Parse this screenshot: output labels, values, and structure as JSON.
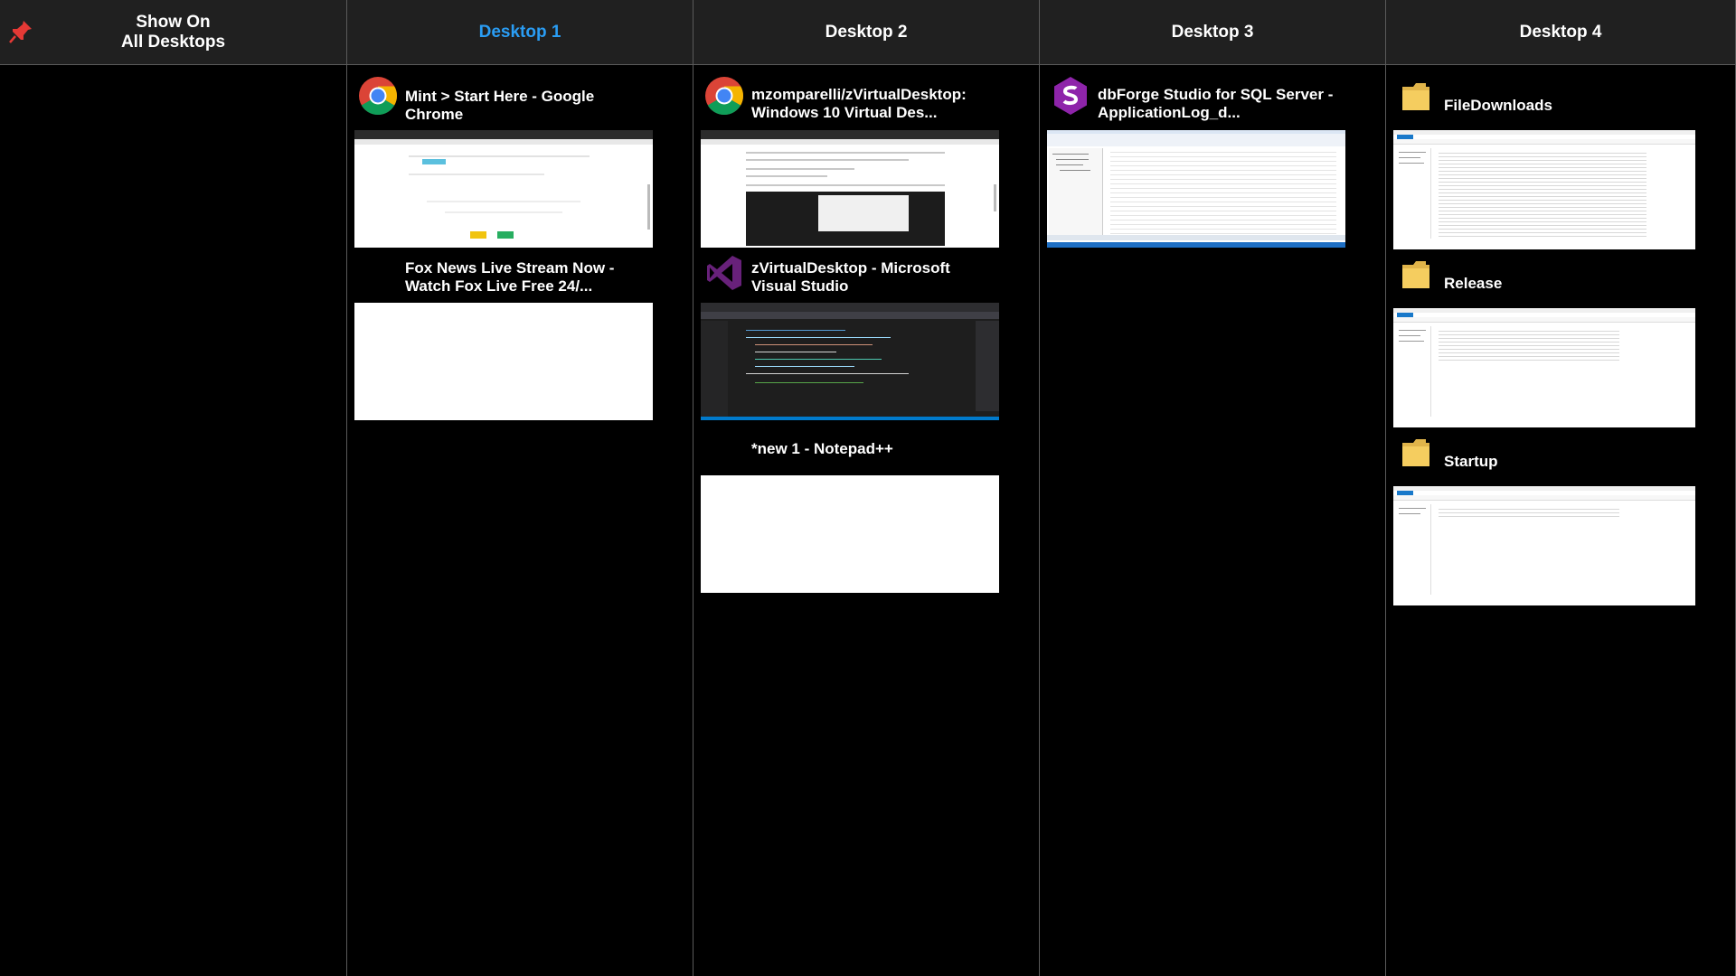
{
  "header": {
    "pinned_label_line1": "Show On",
    "pinned_label_line2": "All Desktops",
    "desktops": [
      "Desktop 1",
      "Desktop 2",
      "Desktop 3",
      "Desktop 4"
    ],
    "active_desktop": "Desktop 1",
    "active_color": "#2a9df4"
  },
  "desktop1": {
    "windows": [
      {
        "title": "Mint > Start Here - Google Chrome",
        "icon": "chrome-icon"
      },
      {
        "title": "Fox News Live Stream Now - Watch Fox Live Free 24/...",
        "icon": ""
      }
    ]
  },
  "desktop2": {
    "windows": [
      {
        "title": "mzomparelli/zVirtualDesktop: Windows 10 Virtual Des...",
        "icon": "chrome-icon"
      },
      {
        "title": "zVirtualDesktop - Microsoft Visual Studio",
        "icon": "visual-studio-icon"
      },
      {
        "title": "*new 1 - Notepad++",
        "icon": ""
      }
    ]
  },
  "desktop3": {
    "windows": [
      {
        "title": "dbForge Studio for SQL Server - ApplicationLog_d...",
        "icon": "dbforge-icon"
      }
    ]
  },
  "desktop4": {
    "windows": [
      {
        "title": "FileDownloads",
        "icon": "folder-icon"
      },
      {
        "title": "Release",
        "icon": "folder-icon"
      },
      {
        "title": "Startup",
        "icon": "folder-icon"
      }
    ]
  }
}
